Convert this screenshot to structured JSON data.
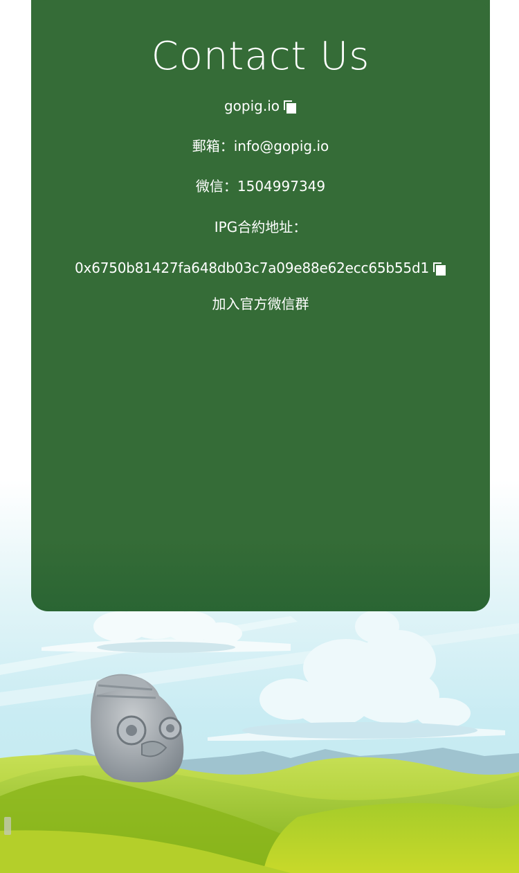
{
  "contact": {
    "title": "Contact Us",
    "site": "gopig.io",
    "email_label": "郵箱：",
    "email": "info@gopig.io",
    "wechat_label": "微信：",
    "wechat": "1504997349",
    "contract_label": "IPG合約地址：",
    "contract_address": "0x6750b81427fa648db03c7a09e88e62ecc65b55d1",
    "join_group": "加入官方微信群"
  },
  "icons": {
    "site_copy": "copy-icon",
    "contract_copy": "copy-icon"
  },
  "colors": {
    "card_green": "#356c37",
    "text": "#ffffff",
    "sky": "#cdeef6",
    "grass": "#9bc41c"
  }
}
